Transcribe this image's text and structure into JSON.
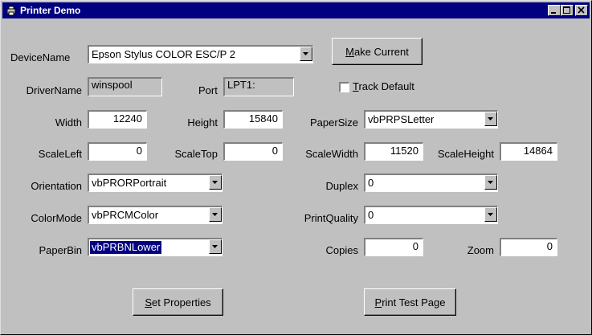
{
  "window": {
    "title": "Printer Demo",
    "min_label": "_",
    "max_label": "□",
    "close_label": "×"
  },
  "device": {
    "label": "DeviceName",
    "value": "Epson Stylus COLOR ESC/P 2",
    "make_current_prefix": "",
    "make_current_ul": "M",
    "make_current_rest": "ake Current"
  },
  "driver": {
    "label": "DriverName",
    "value": "winspool",
    "port_label": "Port",
    "port_value": "LPT1:",
    "track_ul": "T",
    "track_rest": "rack Default",
    "track_checked": false
  },
  "sizes": {
    "width_label": "Width",
    "width_value": "12240",
    "height_label": "Height",
    "height_value": "15840",
    "papersize_label": "PaperSize",
    "papersize_value": "vbPRPSLetter"
  },
  "scale": {
    "left_label": "ScaleLeft",
    "left_value": "0",
    "top_label": "ScaleTop",
    "top_value": "0",
    "width_label": "ScaleWidth",
    "width_value": "11520",
    "height_label": "ScaleHeight",
    "height_value": "14864"
  },
  "orientation": {
    "label": "Orientation",
    "value": "vbPRORPortrait"
  },
  "duplex": {
    "label": "Duplex",
    "value": "0"
  },
  "colormode": {
    "label": "ColorMode",
    "value": "vbPRCMColor"
  },
  "printquality": {
    "label": "PrintQuality",
    "value": "0"
  },
  "paperbin": {
    "label": "PaperBin",
    "value": "vbPRBNLower"
  },
  "copies": {
    "label": "Copies",
    "value": "0"
  },
  "zoom": {
    "label": "Zoom",
    "value": "0"
  },
  "buttons": {
    "set_ul": "S",
    "set_rest": "et Properties",
    "print_ul": "P",
    "print_rest": "rint Test Page"
  }
}
